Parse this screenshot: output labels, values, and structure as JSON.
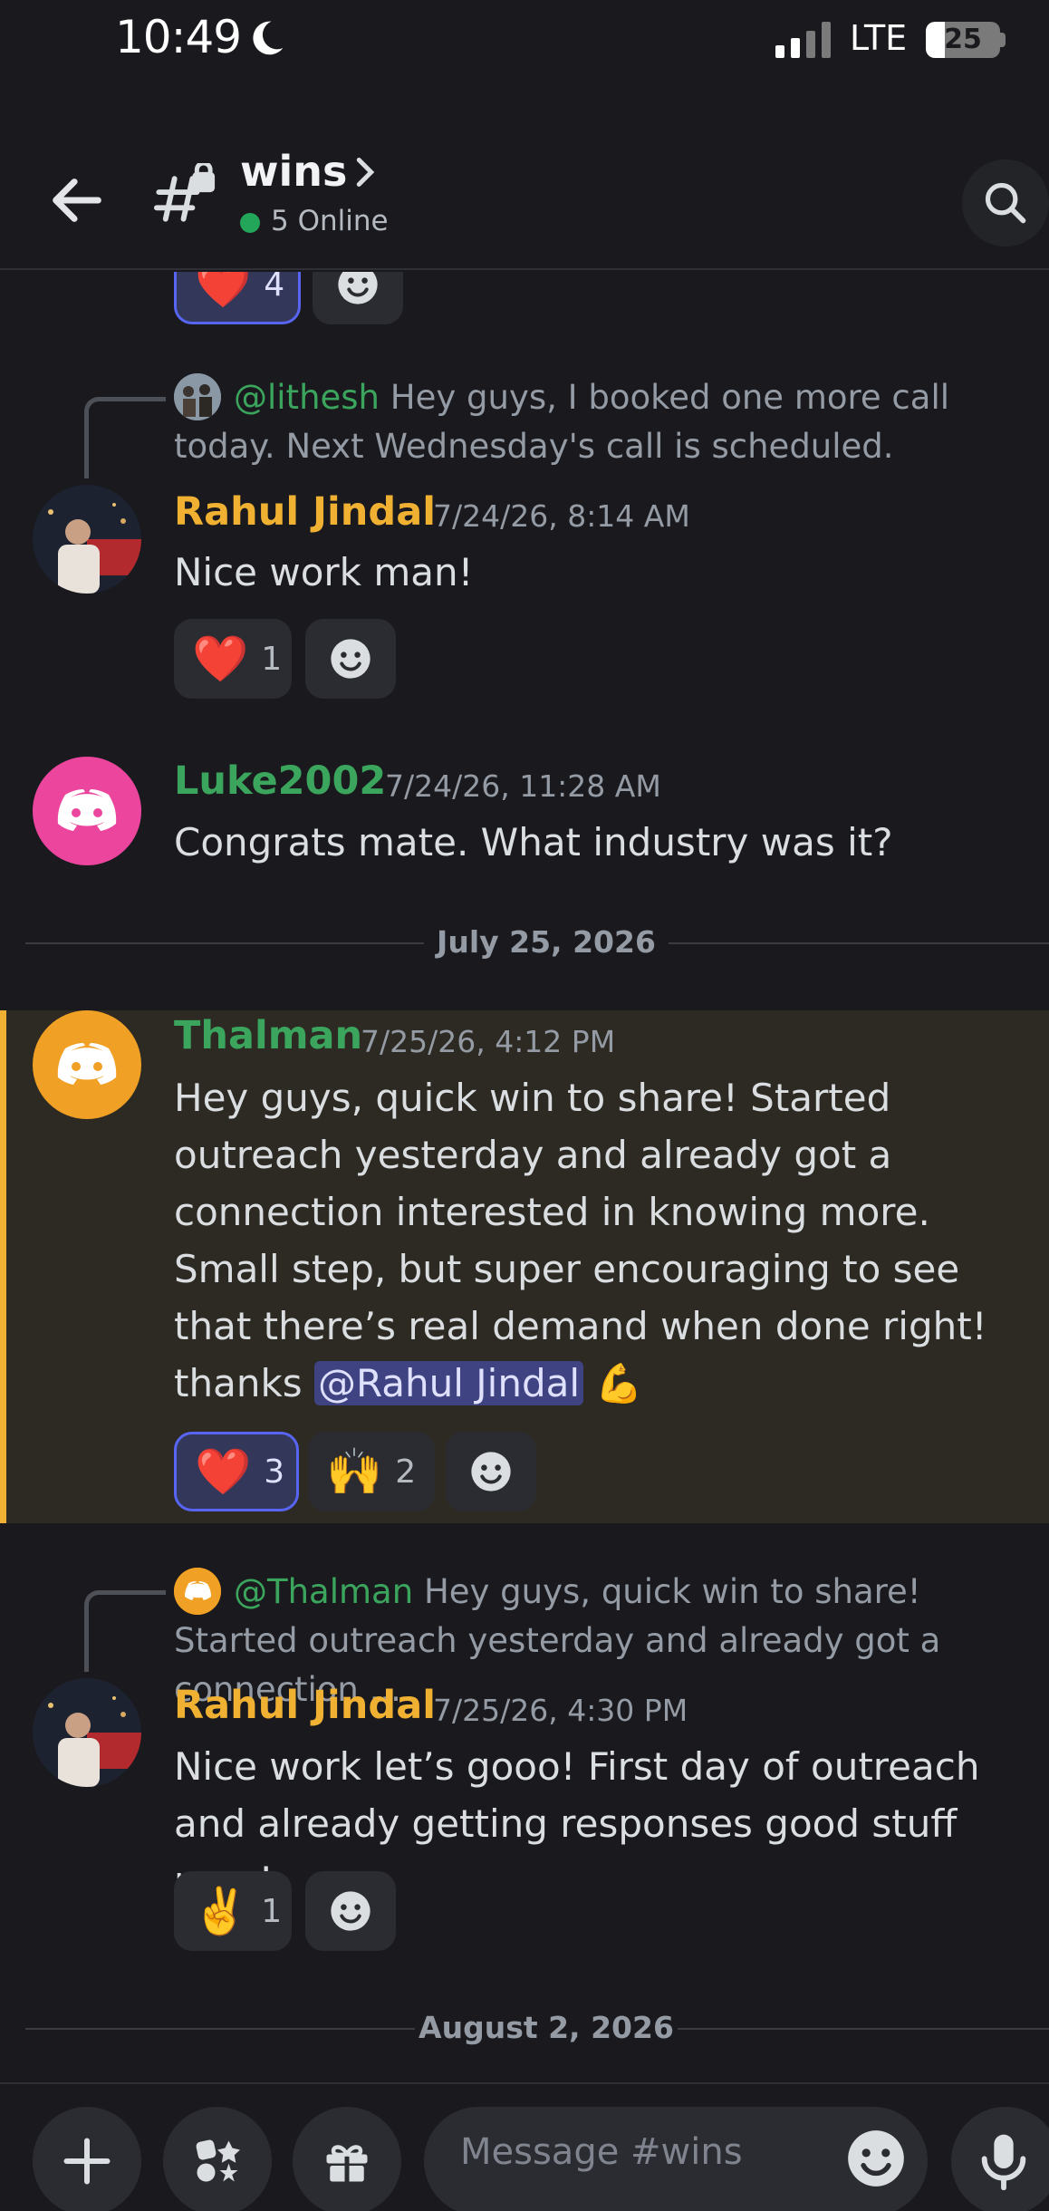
{
  "status_bar": {
    "time": "10:49",
    "network": "LTE",
    "battery": "25",
    "battery_level": 0.25
  },
  "header": {
    "channel": "wins",
    "online": "5 Online"
  },
  "feed": {
    "top_reaction": {
      "emoji": "❤️",
      "count": "4"
    },
    "messages": [
      {
        "reply": {
          "mention": "@lithesh",
          "text": "Hey guys, I booked one more call today. Next Wednesday's call is scheduled."
        },
        "author": "Rahul Jindal",
        "author_color": "#f0b132",
        "timestamp": "7/24/26, 8:14 AM",
        "text": "Nice work man!",
        "reactions": [
          {
            "emoji": "❤️",
            "count": "1"
          }
        ]
      },
      {
        "author": "Luke2002",
        "author_color": "#3ba55d",
        "avatar_color": "#eb459e",
        "timestamp": "7/24/26, 11:28 AM",
        "text": "Congrats mate. What industry was it?"
      },
      {
        "author": "Thalman",
        "author_color": "#3ba55d",
        "avatar_color": "#f0a024",
        "timestamp": "7/25/26, 4:12 PM",
        "text": "Hey guys, quick win to share! Started outreach yesterday and already got a connection interested in knowing more. Small step, but super encouraging to see that there’s real demand when done right! thanks",
        "mention": "@Rahul Jindal",
        "trailing_emoji": "💪",
        "reactions": [
          {
            "emoji": "❤️",
            "count": "3"
          },
          {
            "emoji": "🙌",
            "count": "2"
          }
        ]
      },
      {
        "reply": {
          "mention": "@Thalman",
          "text": "Hey guys, quick win to share! Started outreach yesterday and already got a connection ..."
        },
        "author": "Rahul Jindal",
        "author_color": "#f0b132",
        "timestamp": "7/25/26, 4:30 PM",
        "text": "Nice work let’s gooo! First day of outreach and already getting responses good stuff man!",
        "reactions": [
          {
            "emoji": "✌️",
            "count": "1"
          }
        ]
      }
    ],
    "dividers": [
      "July 25, 2026",
      "August 2, 2026"
    ]
  },
  "composer": {
    "placeholder": "Message #wins"
  },
  "icons": [
    "moon-icon",
    "signal-icon",
    "back-arrow-icon",
    "locked-channel-icon",
    "chevron-right-icon",
    "search-icon",
    "add-reaction-icon",
    "discord-logo-icon",
    "plus-icon",
    "apps-icon",
    "gift-icon",
    "emoji-icon",
    "microphone-icon"
  ]
}
